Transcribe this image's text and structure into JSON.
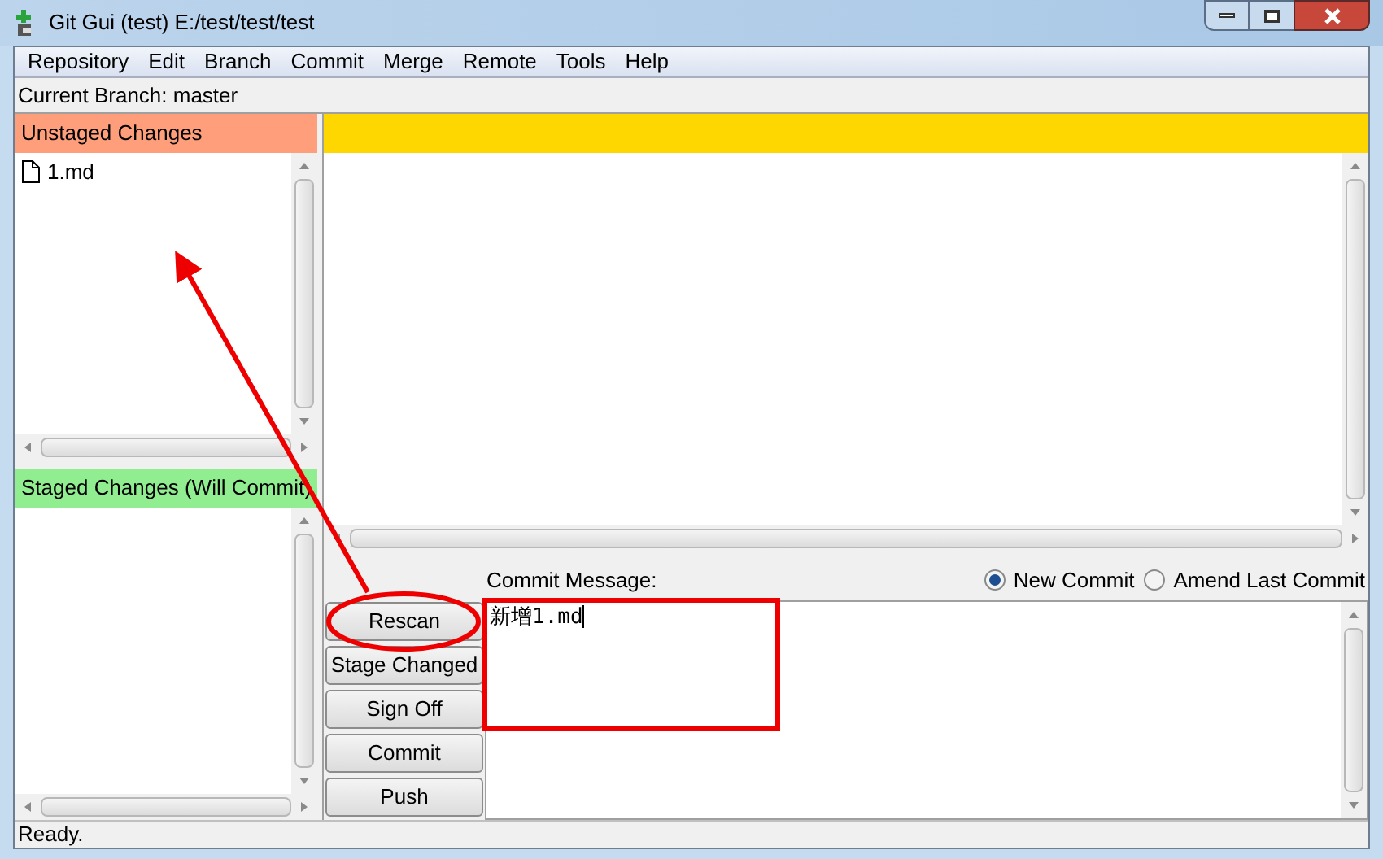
{
  "window": {
    "title": "Git Gui (test) E:/test/test/test"
  },
  "menu": [
    "Repository",
    "Edit",
    "Branch",
    "Commit",
    "Merge",
    "Remote",
    "Tools",
    "Help"
  ],
  "branch": "Current Branch: master",
  "unstaged": {
    "title": "Unstaged Changes",
    "files": [
      "1.md"
    ]
  },
  "staged": {
    "title": "Staged Changes (Will Commit)"
  },
  "commit": {
    "label": "Commit Message:",
    "modes": [
      {
        "label": "New Commit",
        "selected": true
      },
      {
        "label": "Amend Last Commit",
        "selected": false
      }
    ],
    "message": "新增1.md"
  },
  "buttons": [
    "Rescan",
    "Stage Changed",
    "Sign Off",
    "Commit",
    "Push"
  ],
  "status_bar": "Ready."
}
